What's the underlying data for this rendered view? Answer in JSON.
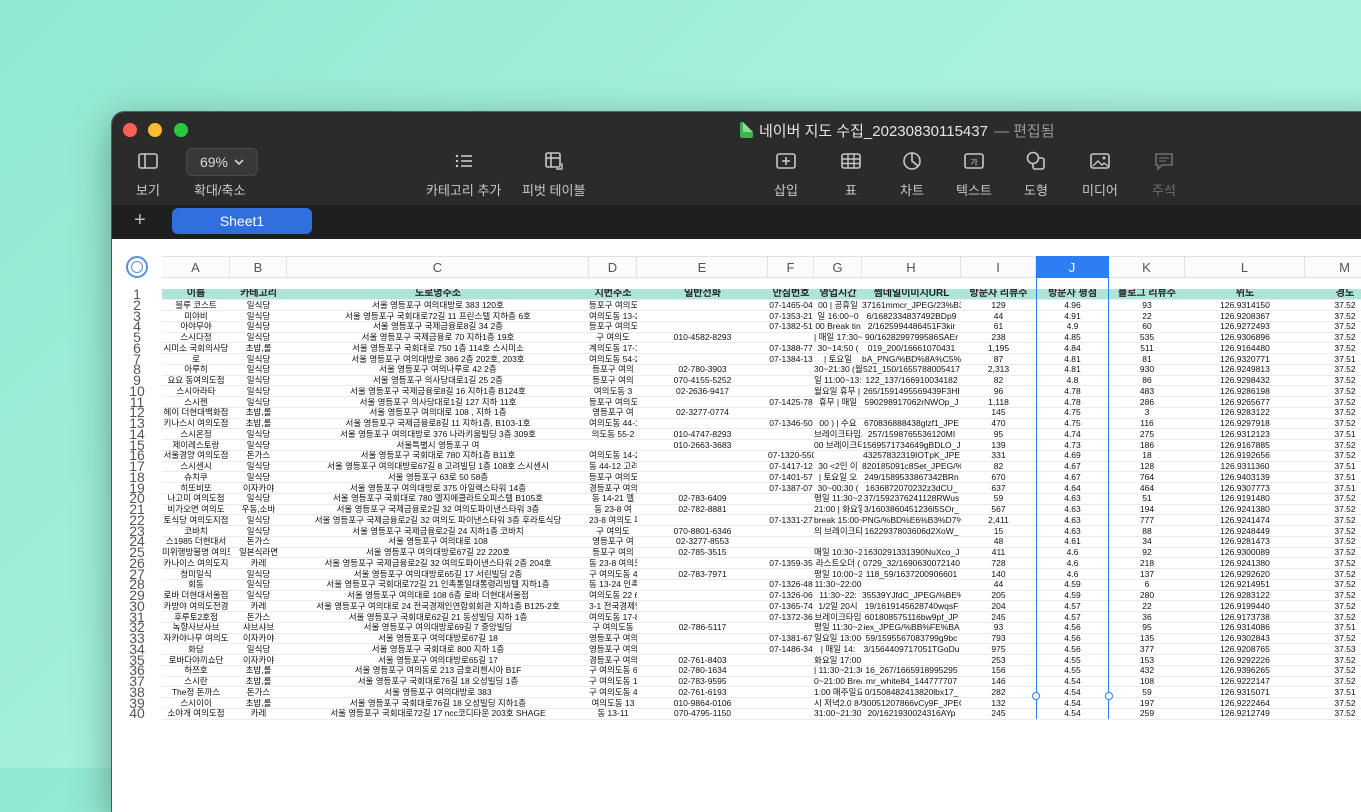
{
  "window": {
    "title": "네이버 지도 수집_20230830115437",
    "status": "— 편집됨"
  },
  "toolbar": {
    "view_label": "보기",
    "zoom_value": "69%",
    "zoom_label": "확대/축소",
    "add_category_label": "카테고리 추가",
    "pivot_table_label": "피벗 테이블",
    "insert_label": "삽입",
    "table_label": "표",
    "chart_label": "차트",
    "text_label": "텍스트",
    "shape_label": "도형",
    "media_label": "미디어",
    "comment_label": "주석"
  },
  "sheet": {
    "add_label": "+",
    "tab_label": "Sheet1",
    "selected_column": "J"
  },
  "columns": [
    "A",
    "B",
    "C",
    "D",
    "E",
    "F",
    "G",
    "H",
    "I",
    "J",
    "K",
    "L",
    "M"
  ],
  "header": [
    "이름",
    "카테고리",
    "도로명주소",
    "지번주소",
    "일반전화",
    "안심번호",
    "영업시간",
    "썸네일이미지URL",
    "방문자 리뷰수",
    "방문자 평점",
    "블로그 리뷰수",
    "위도",
    "경도"
  ],
  "rows": [
    [
      "블루 코스트",
      "일식당",
      "서울 영등포구 여의대방로 383 120호",
      "등포구 여의도동 44-14 120호",
      "",
      "07-1465-04",
      "00 | 공휴일",
      "37161mmcr_JPEG/23%B3",
      "129",
      "4.96",
      "93",
      "126.9314150",
      "37.52"
    ],
    [
      "미야비",
      "일식당",
      "서울 영등포구 국회대로72길 11 프린스텔 지하층 6호",
      "여의도동 13-20 프린스텔 지하층 6호",
      "",
      "07-1353-21",
      "일 16:00~0",
      "6/1682334837492BDp9",
      "44",
      "4.91",
      "22",
      "126.9208367",
      "37.52"
    ],
    [
      "아야무야",
      "일식당",
      "서울 영등포구 국제금융로8길 34 2층",
      "등포구 여의도동 36-4 2층",
      "",
      "07-1382-51",
      "00 Break tin",
      "2/1625994486451F3kir",
      "61",
      "4.9",
      "60",
      "126.9272493",
      "37.52"
    ],
    [
      "스시다정",
      "일식당",
      "서울 영등포구 국제금융로 70 지하1층 19호",
      "구 여의도",
      "010-4582-8293",
      "",
      "| 매일 17:30~22:00 17:",
      "90/1628299799586SAEr",
      "238",
      "4.85",
      "535",
      "126.9306896",
      "37.52"
    ],
    [
      "시미소 국회의사당",
      "초밥,롤",
      "서울 영등포구 국회대로 750 1층 114호 스시미소",
      "계의도동 17-1 1층 114호 스시미소",
      "",
      "07-1388-77",
      "30~14:50 (",
      "019_200/16661070431",
      "1,195",
      "4.84",
      "511",
      "126.9164480",
      "37.52"
    ],
    [
      "로",
      "일식당",
      "서울 영등포구 여의대방로 386 2층 202호, 203호",
      "여의도동 54-2 2층 202호, 203호",
      "",
      "07-1384-13",
      "| 토요일",
      "bA_PNG/%BD%8A%C5%",
      "87",
      "4.81",
      "81",
      "126.9320771",
      "37.51"
    ],
    [
      "아루히",
      "일식당",
      "서울 영등포구 여의나루로 42 2층",
      "등포구 여의",
      "02-780-3903",
      "",
      "30~21:30 (월~일/Break",
      "521_150/1655788005417",
      "2,313",
      "4.81",
      "930",
      "126.9249813",
      "37.52"
    ],
    [
      "요요 동여의도점",
      "일식당",
      "서울 영등포구 의사당대로1길 25 2층",
      "등포구 여의",
      "070-4155-5252",
      "",
      "일 11:00~13:00 | 평일",
      "122_137/166910034182",
      "82",
      "4.8",
      "86",
      "126.9298432",
      "37.52"
    ],
    [
      "스시아라타",
      "일식당",
      "서울 영등포구 국제금융로8길 16 지하1층 B124호",
      "여의도동 3",
      "02-2636-9417",
      "",
      "월요일 휴무 | 일요",
      "265/1591495569439F3HI",
      "96",
      "4.78",
      "483",
      "126.9286198",
      "37.52"
    ],
    [
      "스시젠",
      "일식당",
      "서울 영등포구 의사당대로1길 127 지하 11호",
      "등포구 여의도동 36 지하 11호",
      "",
      "07-1425-78",
      "휴무 | 매일",
      "590298917062rNWOp_J",
      "1,118",
      "4.78",
      "286",
      "126.9265677",
      "37.52"
    ],
    [
      "헤이 더현대백화점",
      "초밥,롤",
      "서울 영등포구 여의대로 108 , 지하 1층",
      "영등포구 여",
      "02-3277-0774",
      "",
      "",
      "",
      "145",
      "4.75",
      "3",
      "126.9283122",
      "37.52"
    ],
    [
      "키나스시 여의도점",
      "초밥,롤",
      "서울 영등포구 국제금융로8길 11 지하1층, B103-1호",
      "여의도동 44-1 지하1층, B103-1호",
      "",
      "07-1346-50",
      "00 ) | 수요",
      "670836888438glzf1_JPE",
      "470",
      "4.75",
      "116",
      "126.9297918",
      "37.52"
    ],
    [
      "스시온정",
      "일식당",
      "서울 영등포구 여의대방로 376 나라키움빌딩 3층 309호",
      "의도동 55-2",
      "010-4747-8293",
      "",
      "브레이크타임으로",
      "257/1598765536120MI",
      "95",
      "4.74",
      "275",
      "126.9312123",
      "37.51"
    ],
    [
      "제이레스토랑",
      "일식당",
      "서울특별시 영등포구 여",
      "",
      "010-2663-3683",
      "",
      "00 브레이크타임: 14:30",
      "1569571734649gBDLO_J",
      "139",
      "4.73",
      "186",
      "126.9167885",
      "37.52"
    ],
    [
      "서울경양 여의도점",
      "돈가스",
      "서울 영등포구 국회대로 780 지하1층 B11호",
      "여의도동 14-21 지하1층 B11호",
      "",
      "07-1320-5501",
      "",
      "43257832319IOTpK_JPE",
      "331",
      "4.69",
      "18",
      "126.9192656",
      "37.52"
    ],
    [
      "스시센시",
      "일식당",
      "서울 영등포구 여의대방로67길 8 고려빌딩 1층 108호 스시센시",
      "동 44-12 고려빌딩 1층 108호 스시센시",
      "",
      "07-1417-12",
      "30 <2인 이",
      "820185091c8Set_JPEG/%",
      "82",
      "4.67",
      "128",
      "126.9311360",
      "37.51"
    ],
    [
      "슈치쿠",
      "일식당",
      "서울 영등포구 63로 50 58층",
      "등포구 여의도동 60 58층",
      "",
      "07-1401-57",
      "| 토요일 오",
      "249/1589533867342BRn",
      "670",
      "4.67",
      "764",
      "126.9403139",
      "37.51"
    ],
    [
      "히또비또",
      "이자카야",
      "서울 영등포구 여의대방로 375 아일렉스타워 14층",
      "경등포구 여의도동 44-37",
      "",
      "07-1387-07",
      "30~00:30 (",
      "1636872070232z3dCU_",
      "637",
      "4.64",
      "464",
      "126.9307773",
      "37.51"
    ],
    [
      "나고미 여의도점",
      "일식당",
      "서울 영등포구 국회대로 780 엘지에클라트오피스텔 B105호",
      "동 14-21 엘",
      "02-783-6409",
      "",
      "평일 11:30~22:00 |",
      "37/1592376241128RWus",
      "59",
      "4.63",
      "51",
      "126.9191480",
      "37.52"
    ],
    [
      "비가오면 여의도",
      "우동,소바",
      "서울 영등포구 국제금융로2길 32 여의도파이낸스타워 3층",
      "동 23-8 여",
      "02-782-8881",
      "",
      "21:00 | 화요일 11:00~2",
      "3/1603860451236l5SOr_",
      "567",
      "4.63",
      "194",
      "126.9241380",
      "37.52"
    ],
    [
      "토식당 여의도지점",
      "일식당",
      "서울 영등포구 국제금융로2길 32 여의도 파이낸스타워 3층 후라토식당",
      "23-8 여의도 파이낸스타워 3층 후라토식당",
      "",
      "07-1331-27",
      "break 15:00~17",
      "PNG/%BD%E6%B3%D7%",
      "2,411",
      "4.63",
      "777",
      "126.9241474",
      "37.52"
    ],
    [
      "코바치",
      "일식당",
      "서울 영등포구 국제금융로2길 24 지하1층 코바치",
      "구 여의도",
      "070-8801-6346",
      "",
      "의 브레이크타임 15:3",
      "1622937803606d2XoW_",
      "15",
      "4.63",
      "88",
      "126.9248449",
      "37.52"
    ],
    [
      "스1985 더현대서",
      "돈가스",
      "서울 영등포구 여의대로 108",
      "영등포구 여",
      "02-3277-8553",
      "",
      "",
      "",
      "48",
      "4.61",
      "34",
      "126.9281473",
      "37.52"
    ],
    [
      "미위행방불명 여의도",
      "일본식라면",
      "서울 영등포구 여의대방로67길 22 220호",
      "등포구 여의",
      "02-785-3515",
      "",
      "매일 10:30~21:30 라스트",
      "1630291331390NuXco_J",
      "411",
      "4.6",
      "92",
      "126.9300089",
      "37.52"
    ],
    [
      "카나이스 여의도지",
      "카레",
      "서울 영등포구 국제금융로2길 32 여의도파이낸스타워 2층 204호",
      "동 23-8 여의도파이낸스타워 2층 204호",
      "",
      "07-1359-35",
      "라스트오더 (",
      "0729_32/1690630072140",
      "728",
      "4.6",
      "218",
      "126.9241380",
      "37.52"
    ],
    [
      "청미일식",
      "일식당",
      "서울 영등포구 여의대방로65길 17 서린빌딩 2층",
      "구 여의도동 4",
      "02-783-7971",
      "",
      "평일 10:00~22:",
      "118_59/1637200906601",
      "140",
      "4.6",
      "137",
      "126.9292620",
      "37.52"
    ],
    [
      "회동",
      "일식당",
      "서울 영등포구 국회대로72길 21 인촉통일대통령리빙텔 지하1층",
      "동 13-24 인촉통일대통령리빙텔 지하1층",
      "",
      "07-1326-48",
      "11:30~22:00",
      "",
      "44",
      "4.59",
      "6",
      "126.9214951",
      "37.52"
    ],
    [
      "로바 더현대서울점",
      "일식당",
      "서울 영등포구 여의대로 108 6층 로바 더현대서울점",
      "여의도동 22 6층 로바 더현대서울점",
      "",
      "07-1326-06",
      "11:30~22:",
      "35539YJfdC_JPEG/%BE%",
      "205",
      "4.59",
      "280",
      "126.9283122",
      "37.52"
    ],
    [
      "카방야 여의도전경",
      "카레",
      "서울 영등포구 여의대로 24 전국경제인연합회회관 지하1층 B125-2호",
      "3-1 전국경제인연합회회관 지하1층 B125-2호",
      "",
      "07-1365-74",
      "1/2일 20시",
      "19/1619145628740wqsF",
      "204",
      "4.57",
      "22",
      "126.9199440",
      "37.52"
    ],
    [
      "후루토2호점",
      "돈가스",
      "서울 영등포구 국회대로62길 21 동성빌딩 지하 1층",
      "여의도동 17-8 동성빌딩 지하 1층",
      "",
      "07-1372-36",
      "브레이크타임",
      "601808575116bw9pf_JP",
      "245",
      "4.57",
      "36",
      "126.9173738",
      "37.52"
    ],
    [
      "녹향사브사브",
      "샤브샤브",
      "서울 영등포구 여의대방로69길 7 중앙빌딩",
      "구 여의도동",
      "02-786-5117",
      "",
      "평일 11:30~21",
      "iex_JPEG/%BB%FE%BA",
      "93",
      "4.56",
      "95",
      "126.9314086",
      "37.51"
    ],
    [
      "자카야나무 여의도",
      "이자카야",
      "서울 영등포구 여의대방로67길 18",
      "영등포구 여의도동 44-6",
      "",
      "07-1381-67",
      "일요일 13:00~2",
      "59/1595567083799g9bc",
      "793",
      "4.56",
      "135",
      "126.9302843",
      "37.52"
    ],
    [
      "화담",
      "일식당",
      "서울 영등포구 국회대로 800 지하 1층",
      "영등포구 여의도동 13 지하 1층",
      "",
      "07-1486-34",
      "| 매일 14:",
      "3/1564409717051TGoDu",
      "975",
      "4.56",
      "377",
      "126.9208765",
      "37.53"
    ],
    [
      "로바다야끼쇼단",
      "이자카야",
      "서울 영등포구 여의대방로65길 17",
      "경등포구 여의",
      "02-761-8403",
      "",
      "화요일 17:00~02:30 | 일요일 휴무",
      "",
      "253",
      "4.55",
      "153",
      "126.9292226",
      "37.52"
    ],
    [
      "하쯔호",
      "초밥,롤",
      "서울 영등포구 여의동로 213 금호리첸시아 B1F",
      "구 여의도동 6",
      "02-780-1634",
      "",
      "| 11:30~21:30 Break tim",
      "16_267/1665918995295",
      "156",
      "4.55",
      "432",
      "126.9396265",
      "37.52"
    ],
    [
      "스시란",
      "초밥,롤",
      "서울 영등포구 국회대로76길 18 오성빌딩 1층",
      "구 여의도동 1",
      "02-783-9595",
      "",
      "0~21:00 Break time 13:",
      "mr_white84_144777707",
      "146",
      "4.54",
      "108",
      "126.9222147",
      "37.52"
    ],
    [
      "The정 돈까스",
      "돈가스",
      "서울 영등포구 여의대방로 383",
      "구 여의도동 4",
      "02-761-6193",
      "",
      "1:00 매주일요일,공휴일휴",
      "0/1508482413820lbx17_",
      "282",
      "4.54",
      "59",
      "126.9315071",
      "37.51"
    ],
    [
      "스시이이",
      "초밥,롤",
      "서울 영등포구 국회대로76길 18 오성빌딩 지하1층",
      "여의도동 13",
      "010-9864-0106",
      "",
      "시 저녁2.0 8시입니다",
      "30051207866vCy9F_JPEG/",
      "132",
      "4.54",
      "197",
      "126.9222464",
      "37.52"
    ],
    [
      "소야개 여의도점",
      "카레",
      "서울 영등포구 국회대로72길 17 ncc코디타운 203호 SHAGE",
      "동 13-11",
      "070-4795-1150",
      "",
      "31:00~21:30 | 일요일",
      "20/1621930024316AYp",
      "245",
      "4.54",
      "259",
      "126.9212749",
      "37.52"
    ]
  ]
}
